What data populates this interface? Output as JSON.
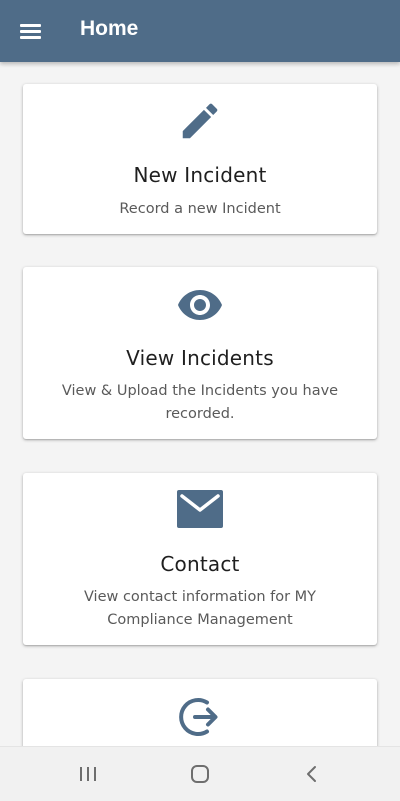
{
  "header": {
    "title": "Home",
    "menu_icon": "menu-icon",
    "background_color": "#4f6c88"
  },
  "cards": [
    {
      "icon": "pencil-icon",
      "title": "New Incident",
      "description": "Record a new Incident"
    },
    {
      "icon": "eye-icon",
      "title": "View Incidents",
      "description": "View & Upload the Incidents you have recorded."
    },
    {
      "icon": "envelope-icon",
      "title": "Contact",
      "description": "View contact information for MY Compliance Management"
    },
    {
      "icon": "logout-icon",
      "title": "",
      "description": ""
    }
  ],
  "system_nav": {
    "buttons": [
      "recent-apps-icon",
      "home-icon",
      "back-icon"
    ]
  },
  "colors": {
    "accent": "#4f6c88",
    "icon": "#4f6c88",
    "card_background": "#ffffff",
    "page_background": "#f4f4f4"
  }
}
